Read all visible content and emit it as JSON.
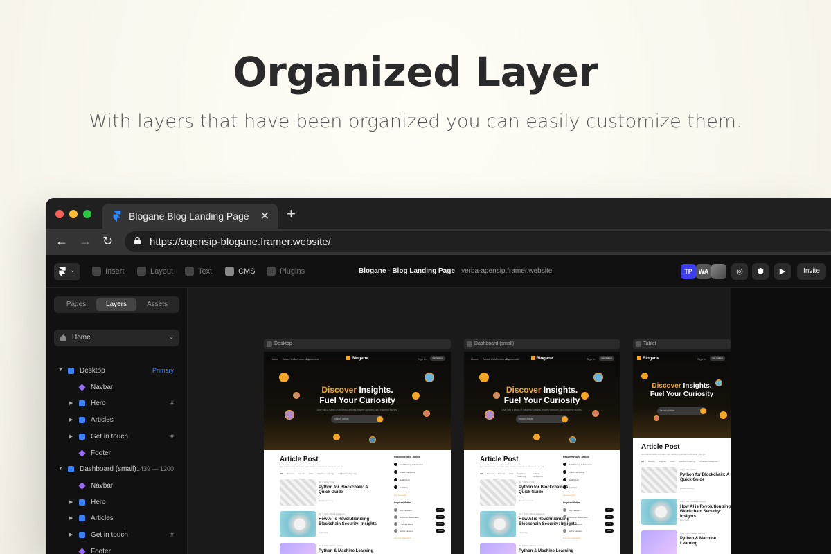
{
  "heading": {
    "title": "Organized Layer",
    "subtitle": "With layers that have been organized you can easily customize them."
  },
  "browser": {
    "tab_title": "Blogane Blog Landing Page",
    "tab_close": "✕",
    "new_tab": "+",
    "back": "←",
    "forward": "→",
    "reload": "↻",
    "url": "https://agensip-blogane.framer.website/"
  },
  "toolbar": {
    "items": [
      "Insert",
      "Layout",
      "Text",
      "CMS",
      "Plugins"
    ],
    "project_title": "Blogane - Blog Landing Page",
    "domain": "· verba-agensip.framer.website",
    "avatars": [
      "TP",
      "WA"
    ],
    "invite": "Invite"
  },
  "sidebar": {
    "tabs": [
      "Pages",
      "Layers",
      "Assets"
    ],
    "active_tab": "Layers",
    "page": "Home",
    "layers": [
      {
        "label": "Desktop",
        "right": "Primary",
        "level": 0,
        "type": "frame",
        "expand": "down"
      },
      {
        "label": "Navbar",
        "right": "",
        "level": 1,
        "type": "component",
        "expand": ""
      },
      {
        "label": "Hero",
        "right": "#",
        "level": 1,
        "type": "frame",
        "expand": "right"
      },
      {
        "label": "Articles",
        "right": "",
        "level": 1,
        "type": "frame",
        "expand": "right"
      },
      {
        "label": "Get in touch",
        "right": "#",
        "level": 1,
        "type": "frame",
        "expand": "right"
      },
      {
        "label": "Footer",
        "right": "",
        "level": 1,
        "type": "component",
        "expand": ""
      },
      {
        "label": "Dashboard (small)",
        "right": "1439 — 1200",
        "level": 0,
        "type": "frame",
        "expand": "down"
      },
      {
        "label": "Navbar",
        "right": "",
        "level": 1,
        "type": "component",
        "expand": ""
      },
      {
        "label": "Hero",
        "right": "",
        "level": 1,
        "type": "frame",
        "expand": "right"
      },
      {
        "label": "Articles",
        "right": "",
        "level": 1,
        "type": "frame",
        "expand": "right"
      },
      {
        "label": "Get in touch",
        "right": "#",
        "level": 1,
        "type": "frame",
        "expand": "right"
      },
      {
        "label": "Footer",
        "right": "",
        "level": 1,
        "type": "component",
        "expand": ""
      }
    ]
  },
  "canvas": {
    "frames": [
      {
        "label": "Desktop"
      },
      {
        "label": "Dashboard (small)"
      },
      {
        "label": "Tablet"
      }
    ],
    "site": {
      "logo": "Blogane",
      "nav": [
        "Home",
        "About Us",
        "Membership",
        "Bookmark"
      ],
      "signin": "Sign In",
      "cta": "Get Started",
      "hero_accent": "Discover",
      "hero_line1_rest": " Insights.",
      "hero_line2": "Fuel Your Curiosity",
      "hero_sub": "Dive into a world of insightful articles, expert opinions, and inspiring stories.",
      "search_placeholder": "Search Article",
      "section_title": "Article Post",
      "section_sub": "Get started today and take your reading experience wherever you go!",
      "filters": [
        "All",
        "Newest",
        "Popular",
        "Web",
        "Machine Learning",
        "Artificial Intelligence"
      ],
      "posts": [
        {
          "date": "Mar 7, 2024",
          "tag": "Python",
          "title": "Python for Blockchain: A Quick Guide",
          "author": "Brandon Simmons"
        },
        {
          "date": "Mar 7, 2024",
          "tag": "Artificial Intelligence",
          "title": "How AI is Revolutionizing Blockchain Security: Insights",
          "author": "Cody Fisher"
        },
        {
          "date": "Mar 6, 2024",
          "tag": "Machine Learning",
          "title": "Python & Machine Learning",
          "author": ""
        }
      ],
      "recommended_title": "Recommended Topics",
      "topics": [
        "Data Privacy & Protection",
        "Cloud Computing",
        "HealthTech",
        "Analytics"
      ],
      "see_more": "See more topics",
      "writers_title": "Inspired Writer",
      "writers": [
        "Guy Hawkins",
        "Cameron Williamson",
        "Theresa Webb",
        "Esther Howard"
      ],
      "follow": "Follow",
      "see_more_writers": "See more suggestions"
    }
  },
  "colors": {
    "accent": "#f5a524",
    "framer_blue": "#3b82f6",
    "component_purple": "#9b6cf6",
    "avatar_tp": "#3d3df0",
    "avatar_wa": "#555555"
  }
}
